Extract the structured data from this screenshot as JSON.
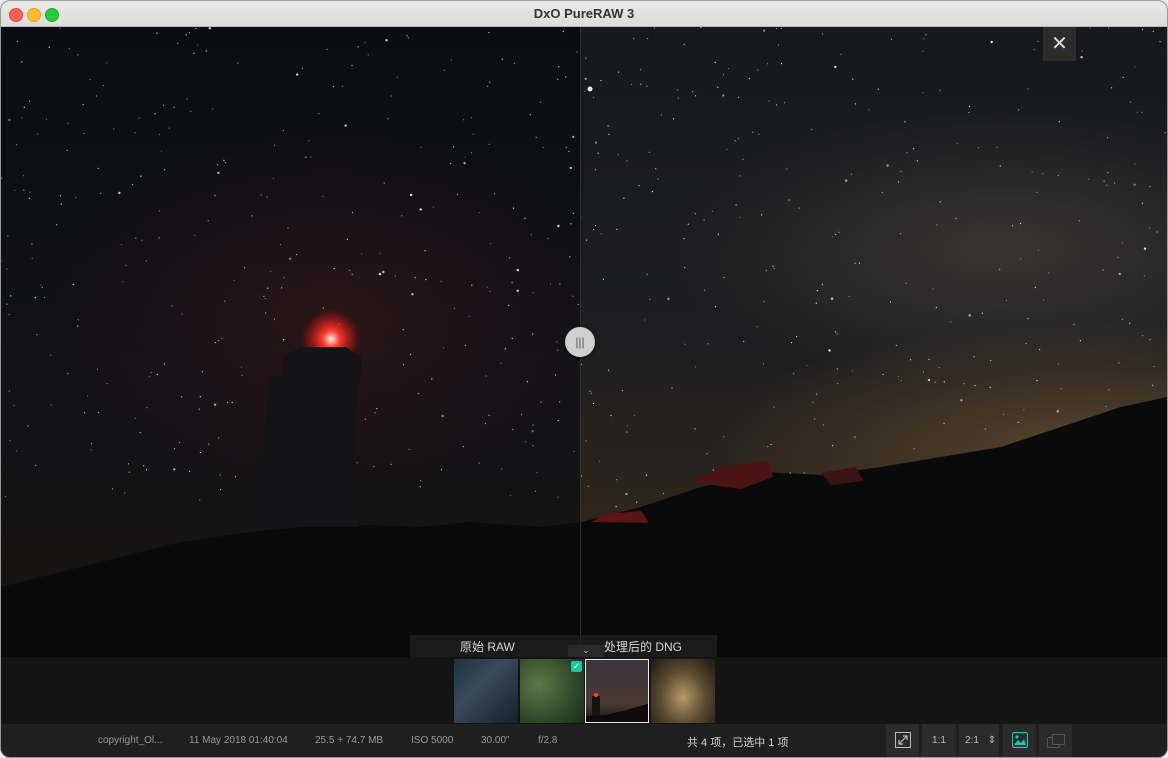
{
  "window": {
    "title": "DxO PureRAW 3"
  },
  "viewer": {
    "close_icon": "close-icon",
    "handle_glyph": "|||",
    "label_raw": "原始 RAW",
    "label_dng": "处理后的 DNG",
    "collapse_glyph": "⌄"
  },
  "filmstrip": {
    "thumbnails": [
      {
        "subject": "indoor blue scene",
        "selected": false,
        "checked": false
      },
      {
        "subject": "green tree",
        "selected": false,
        "checked": true
      },
      {
        "subject": "lighthouse night sky",
        "selected": true,
        "checked": false
      },
      {
        "subject": "library hall",
        "selected": false,
        "checked": false
      }
    ],
    "check_glyph": "✓"
  },
  "status": {
    "copyright": "copyright_Ol...",
    "date": "11 May 2018 01:40:04",
    "size": "25.5 + 74.7 MB",
    "iso": "ISO 5000",
    "exposure": "30.00\"",
    "aperture": "f/2.8",
    "count_text": "共 4 项，已选中 1 项"
  },
  "toolbar": {
    "fit_icon": "fit-to-screen-icon",
    "zoom_1_1": "1:1",
    "zoom_2_1": "2:1",
    "stepper_glyph": "⇕",
    "compare_icon": "compare-view-icon",
    "single_icon": "single-view-icon"
  },
  "colors": {
    "accent": "#22c7a9",
    "check": "#19c3a8"
  }
}
